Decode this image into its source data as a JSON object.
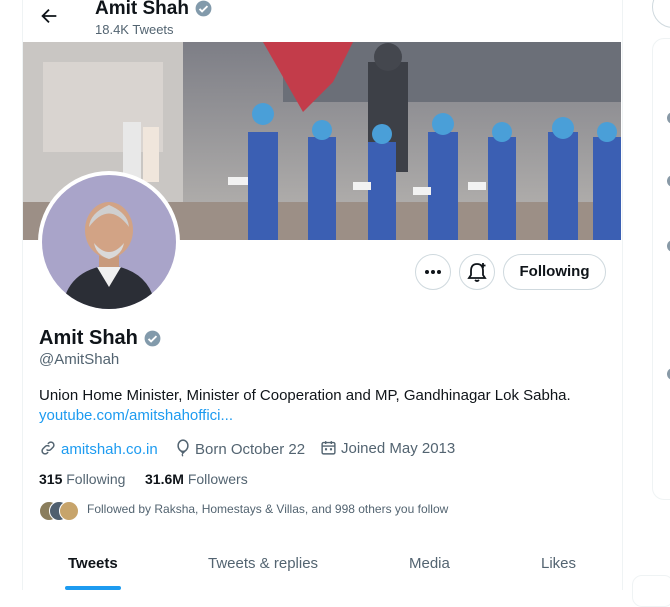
{
  "header": {
    "name": "Amit Shah",
    "tweet_count": "18.4K Tweets"
  },
  "profile": {
    "name": "Amit Shah",
    "handle": "@AmitShah",
    "bio": "Union Home Minister, Minister of Cooperation and MP, Gandhinagar Lok Sabha.",
    "bio_link": "youtube.com/amitshahoffici...",
    "website": "amitshah.co.in",
    "born": "Born October 22",
    "joined": "Joined May 2013",
    "following_count": "315",
    "following_label": "Following",
    "followers_count": "31.6M",
    "followers_label": "Followers",
    "followed_by": "Followed by Raksha, Homestays & Villas, and 998 others you follow"
  },
  "actions": {
    "follow_label": "Following"
  },
  "tabs": [
    {
      "label": "Tweets",
      "active": true
    },
    {
      "label": "Tweets & replies",
      "active": false
    },
    {
      "label": "Media",
      "active": false
    },
    {
      "label": "Likes",
      "active": false
    }
  ],
  "colors": {
    "accent": "#1d9bf0",
    "text": "#0f1419",
    "secondary": "#536471",
    "verified": "#829aab"
  },
  "icons": [
    "back-arrow-icon",
    "verified-badge-icon",
    "more-icon",
    "notification-bell-plus-icon",
    "link-icon",
    "birthday-balloon-icon",
    "calendar-icon"
  ]
}
